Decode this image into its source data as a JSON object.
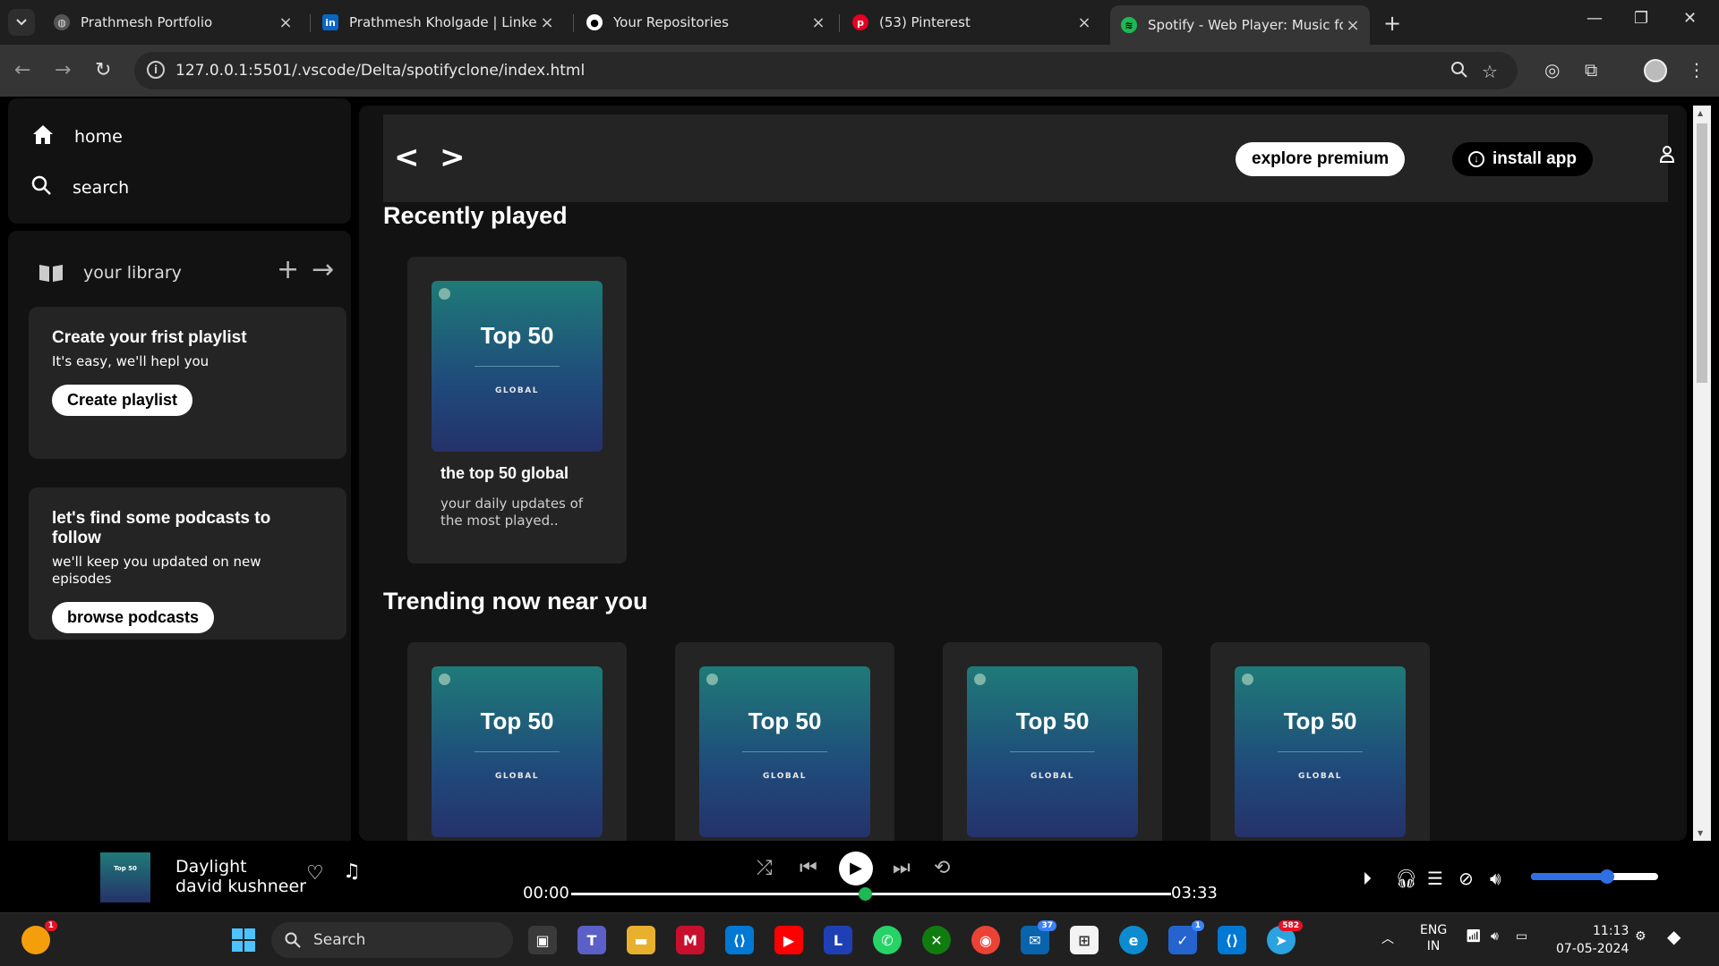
{
  "browser": {
    "tabs": [
      {
        "title": "Prathmesh Portfolio",
        "active": false
      },
      {
        "title": "Prathmesh Kholgade | LinkedIn",
        "active": false
      },
      {
        "title": "Your Repositories",
        "active": false
      },
      {
        "title": "(53) Pinterest",
        "active": false
      },
      {
        "title": "Spotify - Web Player: Music for",
        "active": true
      }
    ],
    "url": "127.0.0.1:5501/.vscode/Delta/spotifyclone/index.html"
  },
  "sidebar": {
    "home": "home",
    "search": "search",
    "library": "your library",
    "playlist_card": {
      "title": "Create your frist playlist",
      "text": "It's easy, we'll hepl you",
      "button": "Create playlist"
    },
    "podcast_card": {
      "title": "let's find some podcasts to follow",
      "text": "we'll keep you updated on new episodes",
      "button": "browse podcasts"
    }
  },
  "header": {
    "back": "<",
    "forward": ">",
    "premium": "explore premium",
    "install": "install app"
  },
  "sections": {
    "recent_title": "Recently played",
    "trending_title": "Trending now near you"
  },
  "cover": {
    "title": "Top 50",
    "subtitle": "GLOBAL"
  },
  "recent_card": {
    "title": "the top 50 global",
    "desc": "your daily updates of the most played.."
  },
  "player": {
    "art_label": "Top 50",
    "track": "Daylight",
    "artist": "david kushneer",
    "elapsed": "00:00",
    "duration": "03:33",
    "progress": 0.49,
    "volume": 0.6
  },
  "taskbar": {
    "search": "Search",
    "lang_top": "ENG",
    "lang_bottom": "IN",
    "time": "11:13",
    "date": "07-05-2024",
    "badges": {
      "user": "1",
      "mail": "37",
      "todo": "1",
      "telegram": "582"
    }
  }
}
